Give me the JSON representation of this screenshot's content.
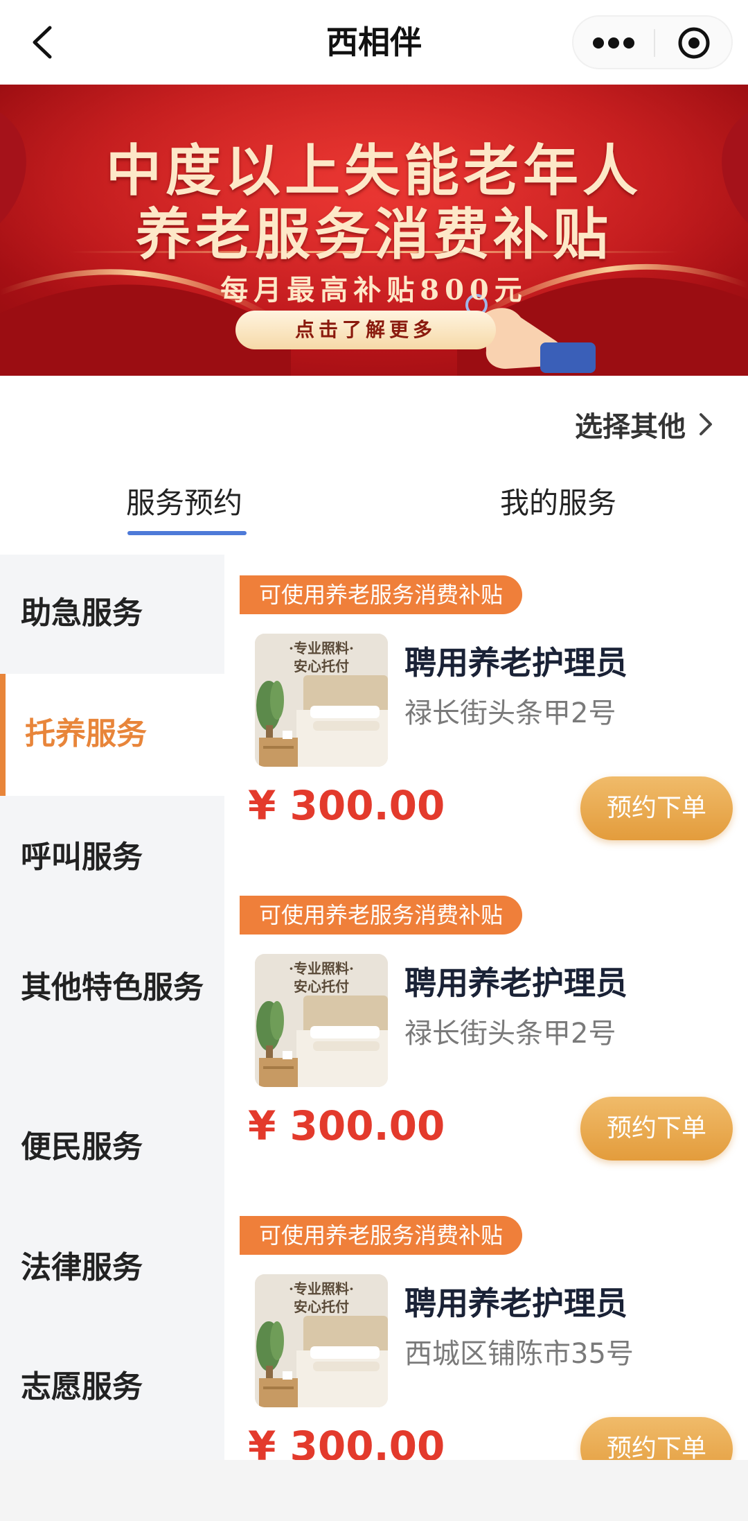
{
  "header": {
    "title": "西相伴",
    "back_icon": "chevron-left-icon",
    "more_icon": "more-dots-icon",
    "close_icon": "target-circle-icon"
  },
  "banner": {
    "line1": "中度以上失能老年人",
    "line2": "养老服务消费补贴",
    "subtitle": "每月最高补贴800元",
    "button_label": "点击了解更多",
    "pager_count": 1,
    "colors": {
      "background": "#c4161c",
      "text": "#fde8c8"
    }
  },
  "select_other": {
    "label": "选择其他",
    "icon": "chevron-right-icon"
  },
  "tabs": [
    {
      "label": "服务预约",
      "active": true
    },
    {
      "label": "我的服务",
      "active": false
    }
  ],
  "sidebar": {
    "items": [
      {
        "label": "助急服务",
        "active": false
      },
      {
        "label": "托养服务",
        "active": true
      },
      {
        "label": "呼叫服务",
        "active": false
      },
      {
        "label": "其他特色服务",
        "active": false
      },
      {
        "label": "便民服务",
        "active": false
      },
      {
        "label": "法律服务",
        "active": false
      },
      {
        "label": "志愿服务",
        "active": false
      }
    ]
  },
  "services": [
    {
      "tag": "可使用养老服务消费补贴",
      "image_caption_line1": "·专业照料·",
      "image_caption_line2": "安心托付",
      "title": "聘用养老护理员",
      "address": "禄长街头条甲2号",
      "price": "¥ 300.00",
      "button_label": "预约下单"
    },
    {
      "tag": "可使用养老服务消费补贴",
      "image_caption_line1": "·专业照料·",
      "image_caption_line2": "安心托付",
      "title": "聘用养老护理员",
      "address": "禄长街头条甲2号",
      "price": "¥ 300.00",
      "button_label": "预约下单"
    },
    {
      "tag": "可使用养老服务消费补贴",
      "image_caption_line1": "·专业照料·",
      "image_caption_line2": "安心托付",
      "title": "聘用养老护理员",
      "address": "西城区铺陈市35号",
      "price": "¥ 300.00",
      "button_label": "预约下单"
    }
  ],
  "colors": {
    "accent_orange": "#e8853a",
    "tag_orange": "#ef7f3a",
    "price_red": "#e33a2c",
    "tab_underline": "#4e7ad8"
  }
}
